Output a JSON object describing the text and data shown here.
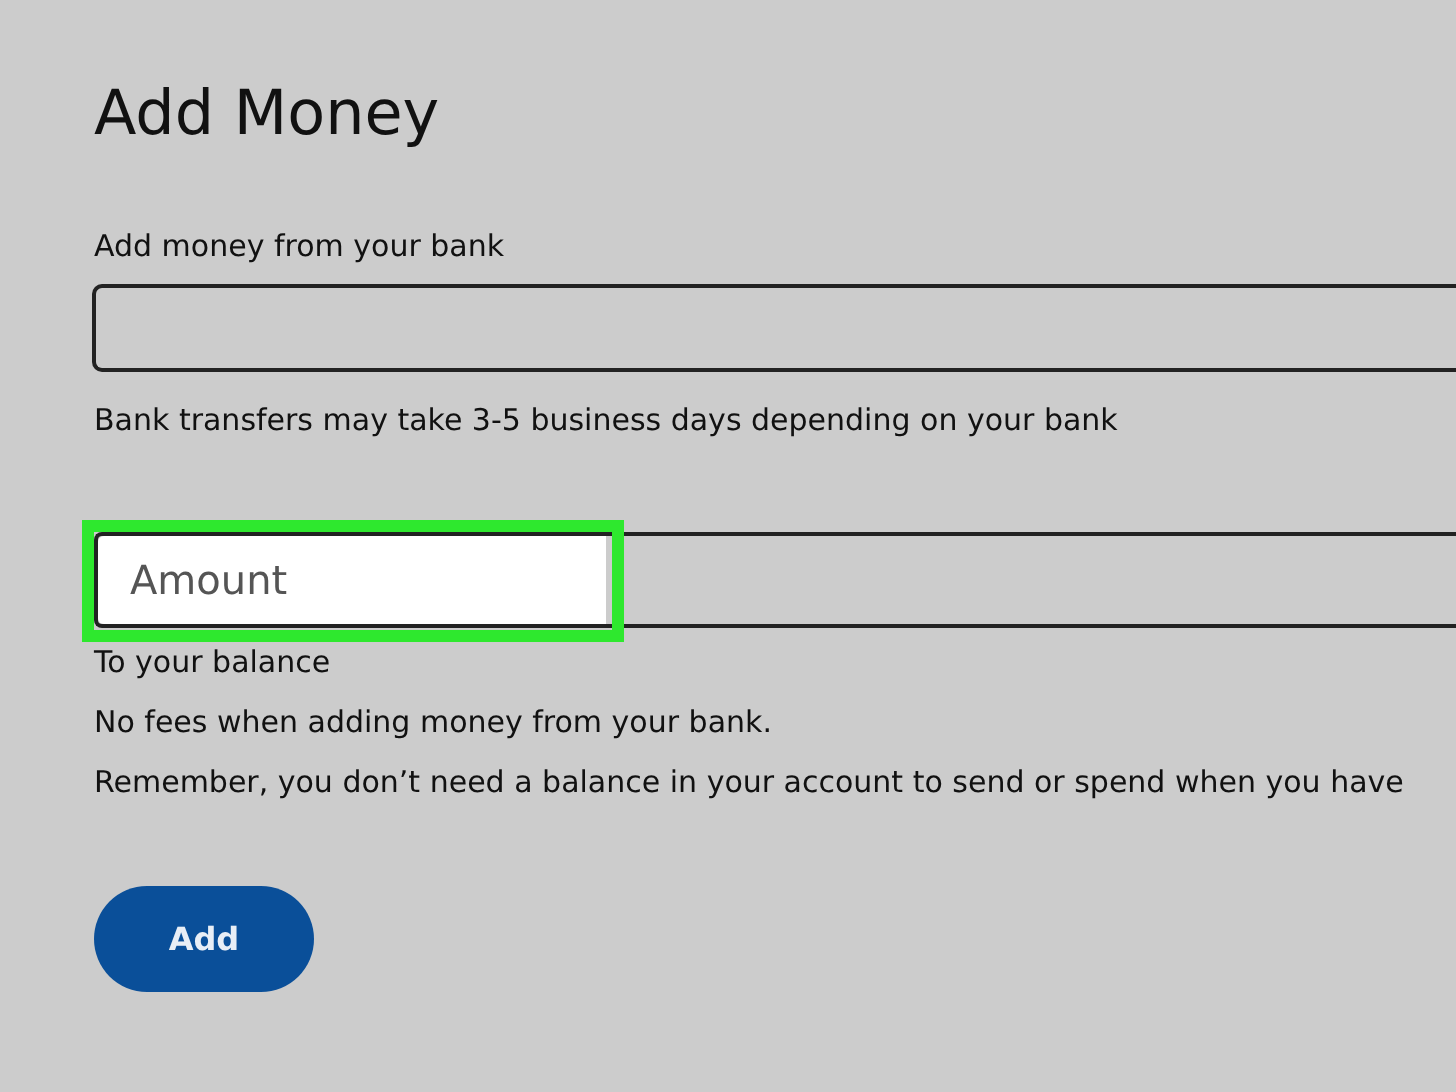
{
  "title": "Add Money",
  "bank_field": {
    "label": "Add money from your bank"
  },
  "bank_note": "Bank transfers may take 3-5 business days depending on your bank",
  "amount_field": {
    "placeholder": "Amount",
    "highlighted": true
  },
  "amount_caption": "To your balance",
  "notes": [
    "No fees when adding money from your bank.",
    "Remember, you don’t need a balance in your account to send or spend when you have"
  ],
  "add_button": "Add"
}
